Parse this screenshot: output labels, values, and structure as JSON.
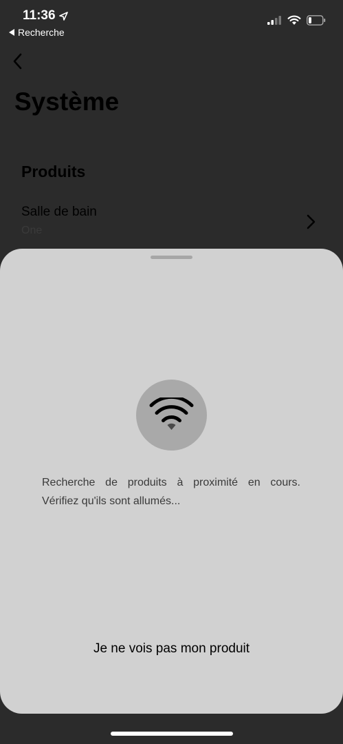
{
  "status_bar": {
    "time": "11:36",
    "back_app_label": "Recherche",
    "icons": [
      "location-arrow-icon",
      "cellular-signal-icon",
      "wifi-icon",
      "battery-icon"
    ]
  },
  "page": {
    "title": "Système",
    "section_title": "Produits",
    "product_row": {
      "name": "Salle de bain",
      "model": "One"
    }
  },
  "sheet": {
    "icon": "wifi-icon",
    "message_line1": "Recherche de produits à proximité en cours.",
    "message_line2": "Vérifiez qu'ils sont allumés...",
    "not_found_button": "Je ne vois pas mon produit"
  },
  "colors": {
    "sheet_background": "#d1d1d1",
    "icon_circle": "#a9a9a9",
    "dimmed_background": "#2b2b2b"
  }
}
